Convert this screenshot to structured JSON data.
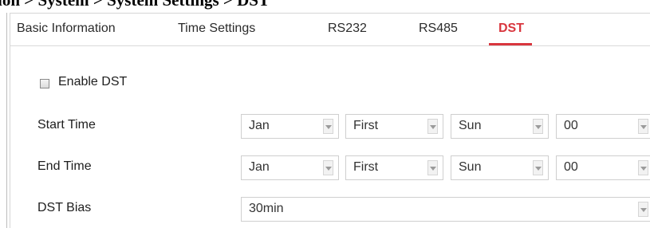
{
  "breadcrumb": "guration > System > System Settings > DST",
  "tabs": [
    {
      "label": "Basic Information",
      "active": false
    },
    {
      "label": "Time Settings",
      "active": false
    },
    {
      "label": "RS232",
      "active": false
    },
    {
      "label": "RS485",
      "active": false
    },
    {
      "label": "DST",
      "active": true
    }
  ],
  "enable_dst": {
    "label": "Enable DST",
    "checked": false
  },
  "start_time": {
    "label": "Start Time",
    "month": "Jan",
    "week": "First",
    "day": "Sun",
    "hour": "00"
  },
  "end_time": {
    "label": "End Time",
    "month": "Jan",
    "week": "First",
    "day": "Sun",
    "hour": "00"
  },
  "dst_bias": {
    "label": "DST Bias",
    "value": "30min"
  },
  "colors": {
    "active_tab": "#d9363e",
    "border": "#cfcfcf"
  },
  "icons": {
    "dropdown": "chevron-down-icon",
    "checkbox": "checkbox-unchecked-icon"
  }
}
